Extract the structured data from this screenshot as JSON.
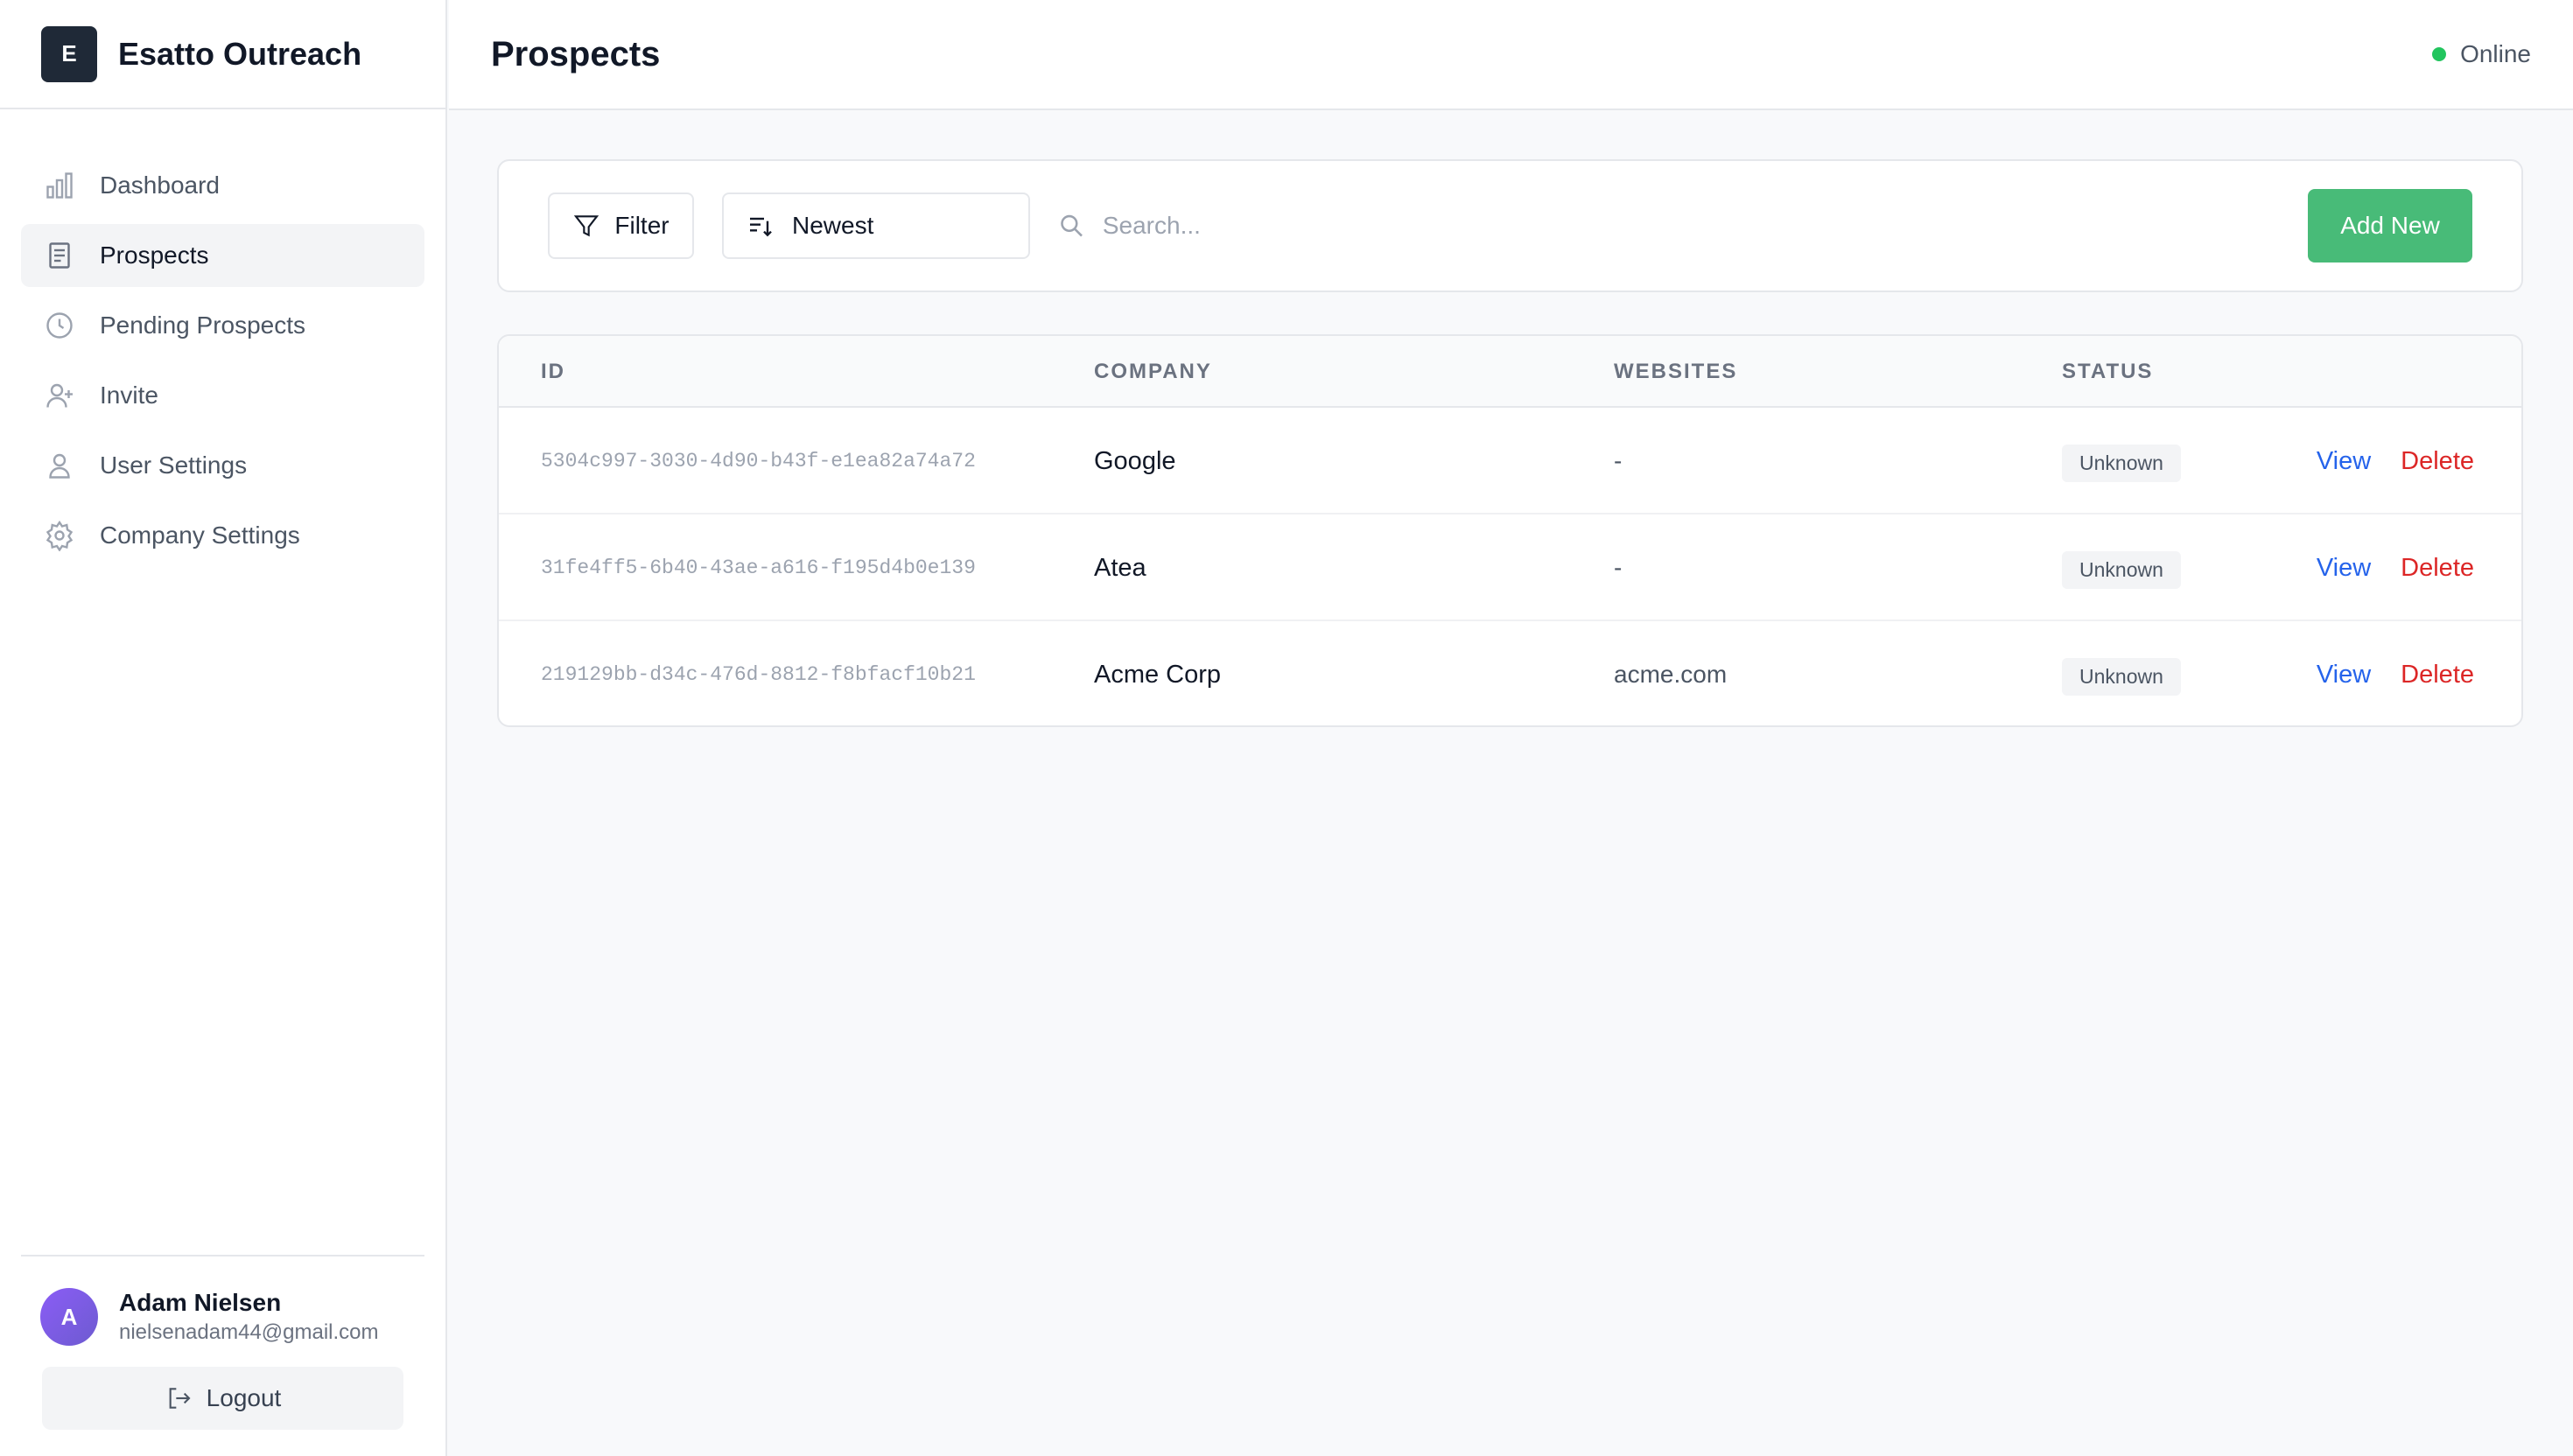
{
  "app": {
    "logo_letter": "E",
    "name": "Esatto Outreach"
  },
  "sidebar": {
    "items": [
      {
        "label": "Dashboard",
        "icon": "bar-chart-icon"
      },
      {
        "label": "Prospects",
        "icon": "document-icon",
        "active": true
      },
      {
        "label": "Pending Prospects",
        "icon": "clock-icon"
      },
      {
        "label": "Invite",
        "icon": "user-plus-icon"
      },
      {
        "label": "User Settings",
        "icon": "user-icon"
      },
      {
        "label": "Company Settings",
        "icon": "gear-icon"
      }
    ]
  },
  "user": {
    "initial": "A",
    "name": "Adam Nielsen",
    "email": "nielsenadam44@gmail.com",
    "logout_label": "Logout"
  },
  "header": {
    "title": "Prospects",
    "status": "Online",
    "status_color": "#22c55e"
  },
  "toolbar": {
    "filter_label": "Filter",
    "sort_value": "Newest",
    "search_placeholder": "Search...",
    "add_label": "Add New",
    "add_color": "#48bb78"
  },
  "table": {
    "columns": [
      "ID",
      "COMPANY",
      "WEBSITES",
      "STATUS"
    ],
    "rows": [
      {
        "id": "5304c997-3030-4d90-b43f-e1ea82a74a72",
        "company": "Google",
        "websites": "-",
        "status": "Unknown",
        "view": "View",
        "delete": "Delete"
      },
      {
        "id": "31fe4ff5-6b40-43ae-a616-f195d4b0e139",
        "company": "Atea",
        "websites": "-",
        "status": "Unknown",
        "view": "View",
        "delete": "Delete"
      },
      {
        "id": "219129bb-d34c-476d-8812-f8bfacf10b21",
        "company": "Acme Corp",
        "websites": "acme.com",
        "status": "Unknown",
        "view": "View",
        "delete": "Delete"
      }
    ]
  }
}
